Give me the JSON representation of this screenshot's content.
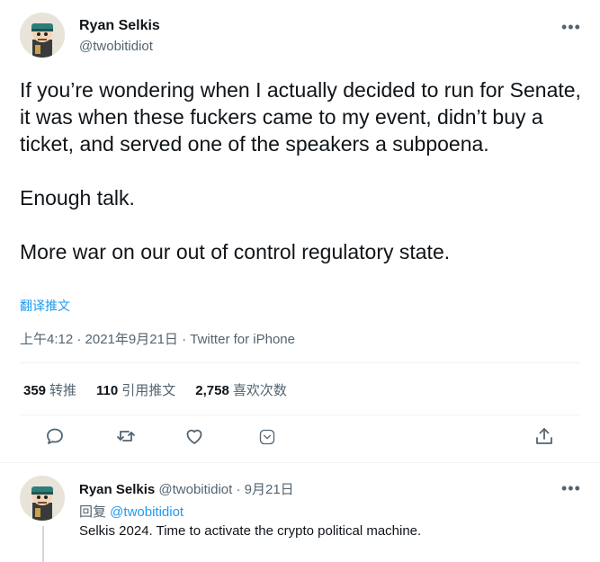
{
  "main_tweet": {
    "author_name": "Ryan Selkis",
    "author_handle": "@twobitidiot",
    "paragraphs": [
      "If you’re wondering when I actually decided to run for Senate, it was when these fuckers came to my event, didn’t buy a ticket, and served one of the speakers a subpoena.",
      "Enough talk.",
      "More war on our out of control regulatory state."
    ],
    "translate_label": "翻译推文",
    "timestamp": "上午4:12 · 2021年9月21日",
    "separator": " · ",
    "source": "Twitter for iPhone",
    "stats": {
      "retweets_count": "359",
      "retweets_label": "转推",
      "quotes_count": "110",
      "quotes_label": "引用推文",
      "likes_count": "2,758",
      "likes_label": "喜欢次数"
    },
    "more_icon": "more-horizontal-icon"
  },
  "actions": [
    "reply-icon",
    "retweet-icon",
    "like-icon",
    "tip-icon",
    "share-icon"
  ],
  "reply_tweet": {
    "author_name": "Ryan Selkis",
    "author_handle": "@twobitidiot",
    "date": " · 9月21日",
    "replying_label": "回复 ",
    "replying_to": "@twobitidiot",
    "text": "Selkis 2024. Time to activate the crypto political machine."
  },
  "colors": {
    "accent": "#1d9bf0",
    "secondary_text": "#536471",
    "primary_text": "#0f1419",
    "divider": "#eff3f4"
  }
}
